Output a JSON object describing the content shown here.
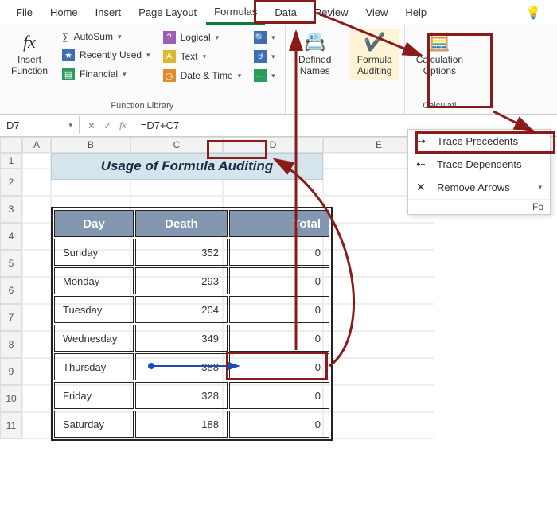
{
  "tabs": {
    "file": "File",
    "home": "Home",
    "insert": "Insert",
    "pagelayout": "Page Layout",
    "formulas": "Formulas",
    "data": "Data",
    "review": "Review",
    "view": "View",
    "help": "Help"
  },
  "ribbon": {
    "insert_function": "Insert\nFunction",
    "autosum": "AutoSum",
    "recently": "Recently Used",
    "financial": "Financial",
    "logical": "Logical",
    "text": "Text",
    "datetime": "Date & Time",
    "function_library": "Function Library",
    "defined_names": "Defined\nNames",
    "formula_auditing": "Formula\nAuditing",
    "calculation_options": "Calculation\nOptions",
    "calculation": "Calculati"
  },
  "dropdown": {
    "trace_precedents": "Trace Precedents",
    "trace_dependents": "Trace Dependents",
    "remove_arrows": "Remove Arrows",
    "foot": "Fo"
  },
  "namebox": "D7",
  "formula": "=D7+C7",
  "columns": {
    "a": "A",
    "b": "B",
    "c": "C",
    "d": "D",
    "e": "E"
  },
  "sheet": {
    "title": "Usage of Formula Auditing",
    "headers": {
      "day": "Day",
      "death": "Death",
      "total": "Total"
    },
    "rows": [
      {
        "day": "Sunday",
        "death": "352",
        "total": "0"
      },
      {
        "day": "Monday",
        "death": "293",
        "total": "0"
      },
      {
        "day": "Tuesday",
        "death": "204",
        "total": "0"
      },
      {
        "day": "Wednesday",
        "death": "349",
        "total": "0"
      },
      {
        "day": "Thursday",
        "death": "388",
        "total": "0"
      },
      {
        "day": "Friday",
        "death": "328",
        "total": "0"
      },
      {
        "day": "Saturday",
        "death": "188",
        "total": "0"
      }
    ]
  },
  "rownums": [
    "1",
    "2",
    "3",
    "4",
    "5",
    "6",
    "7",
    "8",
    "9",
    "10",
    "11"
  ]
}
